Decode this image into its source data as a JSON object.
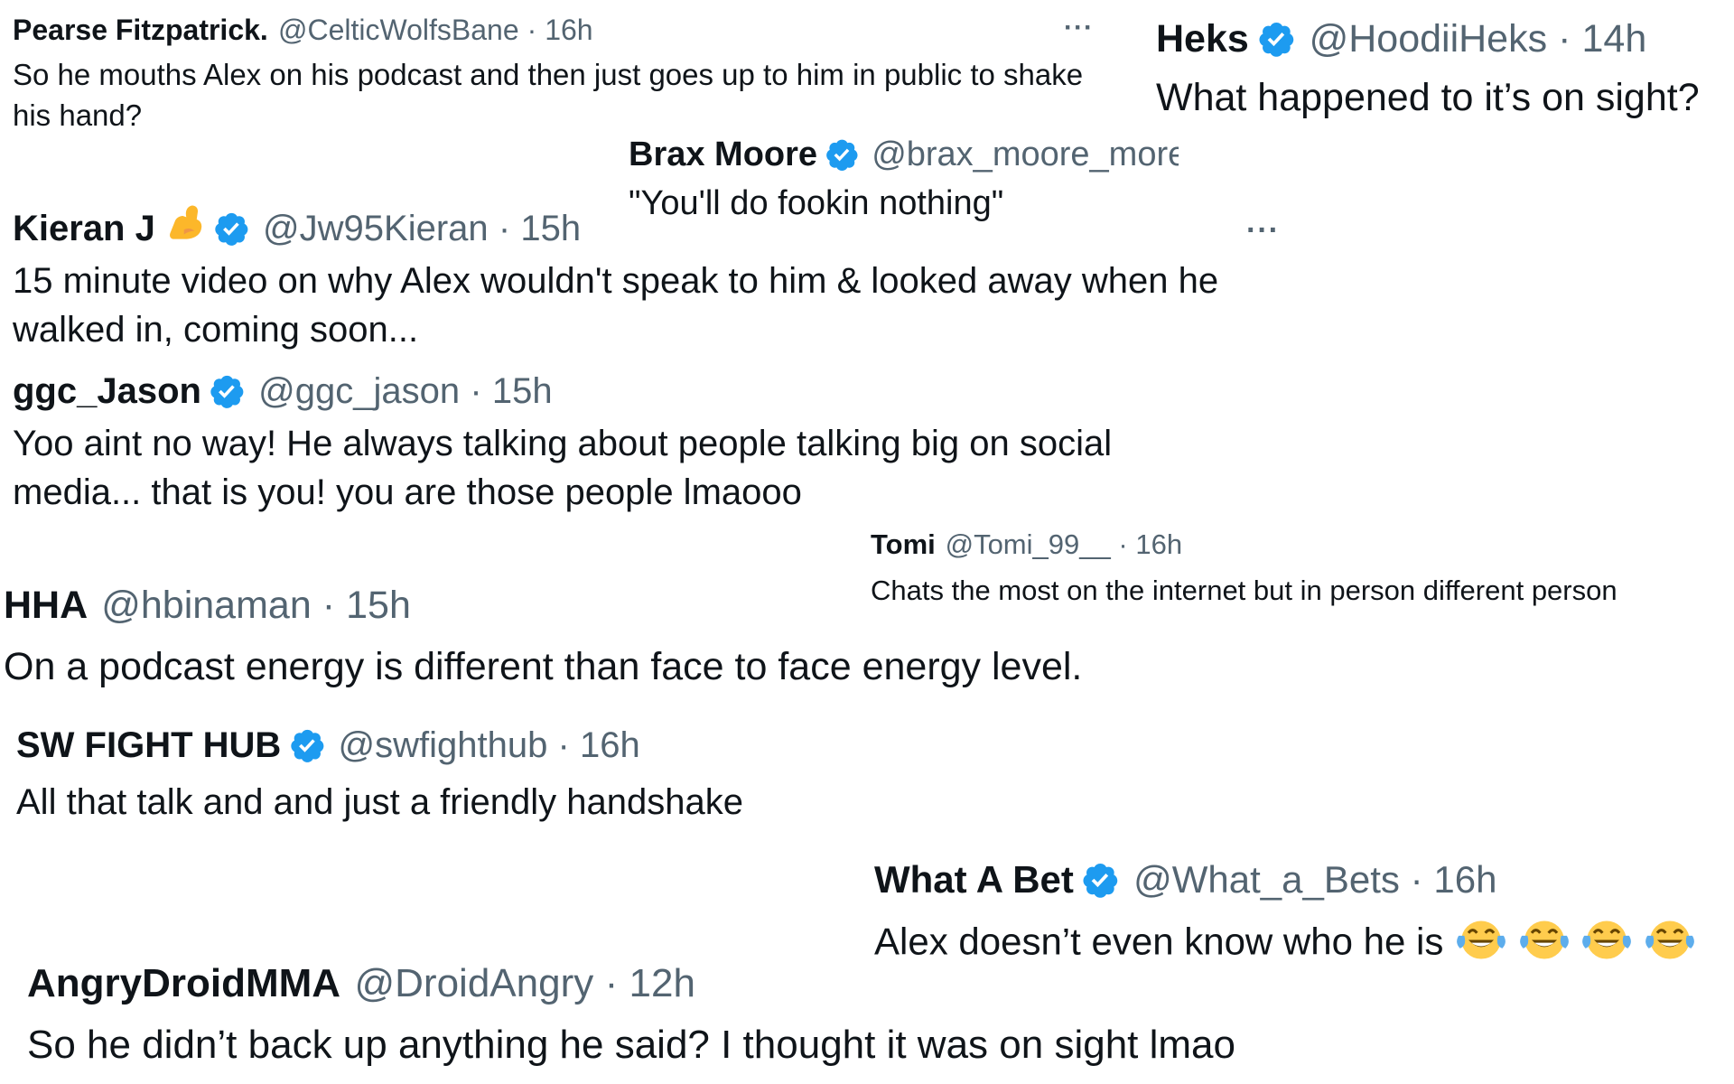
{
  "colors": {
    "badge": "#1d9bf0",
    "text": "#0f1419",
    "muted": "#536471"
  },
  "tweets": [
    {
      "name": "Pearse Fitzpatrick.",
      "handle": "@CelticWolfsBane",
      "sep": "·",
      "time": "16h",
      "more": "···",
      "text": "So he mouths Alex on his podcast and then just goes up to him in public to shake his hand?"
    },
    {
      "name": "Heks",
      "verified": true,
      "handle": "@HoodiiHeks",
      "sep": "·",
      "time": "14h",
      "text": "What happened to it’s on sight?"
    },
    {
      "name": "Brax Moore",
      "verified": true,
      "handle": "@brax_moore_more",
      "text": "\"You'll do fookin nothing\""
    },
    {
      "name": "Kieran J",
      "name_emoji": "flexed-biceps-emoji",
      "verified": true,
      "handle": "@Jw95Kieran",
      "sep": "·",
      "time": "15h",
      "more": "···",
      "text": "15 minute video on why Alex wouldn't speak to him & looked away when he walked in, coming soon..."
    },
    {
      "name": "ggc_Jason",
      "verified": true,
      "handle": "@ggc_jason",
      "sep": "·",
      "time": "15h",
      "text": "Yoo aint no way! He always talking about people talking big on social media... that is you! you are those people lmaooo"
    },
    {
      "name": "Tomi",
      "handle": "@Tomi_99__",
      "sep": "·",
      "time": "16h",
      "text": "Chats the most on the internet but in person different person"
    },
    {
      "name": "HHA",
      "handle": "@hbinaman",
      "sep": "·",
      "time": "15h",
      "text": "On a podcast energy is different than face to face energy level."
    },
    {
      "name": "SW FIGHT HUB",
      "verified": true,
      "handle": "@swfighthub",
      "sep": "·",
      "time": "16h",
      "text": "All that talk and and just a friendly handshake"
    },
    {
      "name": "What A Bet",
      "verified": true,
      "handle": "@What_a_Bets",
      "sep": "·",
      "time": "16h",
      "text": "Alex doesn’t even know who he is",
      "text_emoji": [
        "face-with-tears-of-joy-emoji",
        "face-with-tears-of-joy-emoji",
        "face-with-tears-of-joy-emoji",
        "face-with-tears-of-joy-emoji"
      ]
    },
    {
      "name": "AngryDroidMMA",
      "handle": "@DroidAngry",
      "sep": "·",
      "time": "12h",
      "text": "So he didn’t back up anything he said? I thought it was on sight lmao"
    }
  ]
}
